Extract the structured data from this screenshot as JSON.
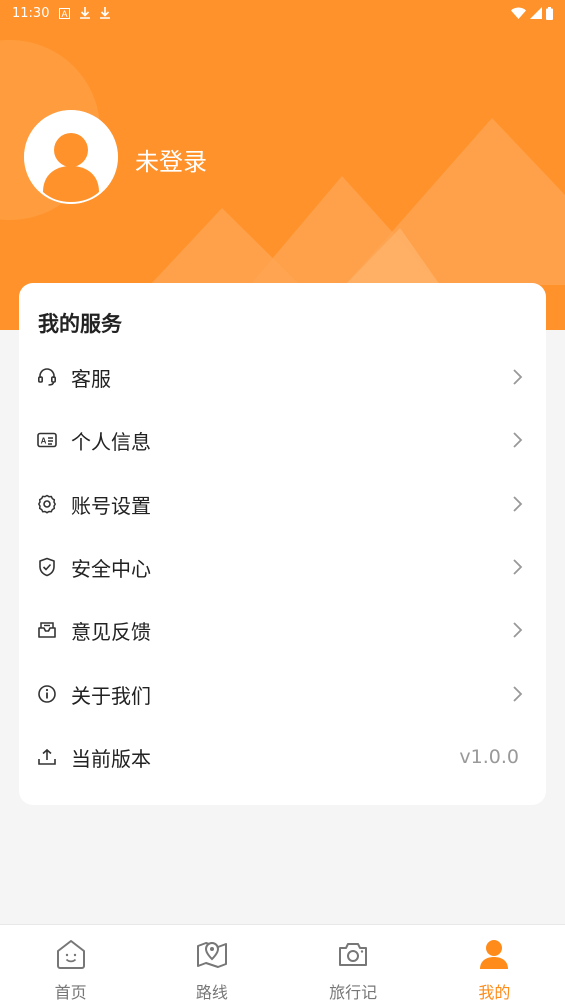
{
  "status_bar": {
    "time": "11:30"
  },
  "profile": {
    "username": "未登录"
  },
  "services": {
    "title": "我的服务",
    "items": [
      {
        "label": "客服",
        "icon": "headset-icon"
      },
      {
        "label": "个人信息",
        "icon": "id-card-icon"
      },
      {
        "label": "账号设置",
        "icon": "gear-icon"
      },
      {
        "label": "安全中心",
        "icon": "shield-check-icon"
      },
      {
        "label": "意见反馈",
        "icon": "feedback-mail-icon"
      },
      {
        "label": "关于我们",
        "icon": "info-icon"
      },
      {
        "label": "当前版本",
        "icon": "upload-icon",
        "value": "v1.0.0"
      }
    ]
  },
  "tabbar": {
    "items": [
      {
        "label": "首页",
        "icon": "home-icon"
      },
      {
        "label": "路线",
        "icon": "map-pin-icon"
      },
      {
        "label": "旅行记",
        "icon": "camera-icon"
      },
      {
        "label": "我的",
        "icon": "user-icon",
        "active": true
      }
    ]
  },
  "colors": {
    "accent": "#ff922b",
    "active_tab": "#ff8c1a",
    "background": "#f5f5f5"
  }
}
